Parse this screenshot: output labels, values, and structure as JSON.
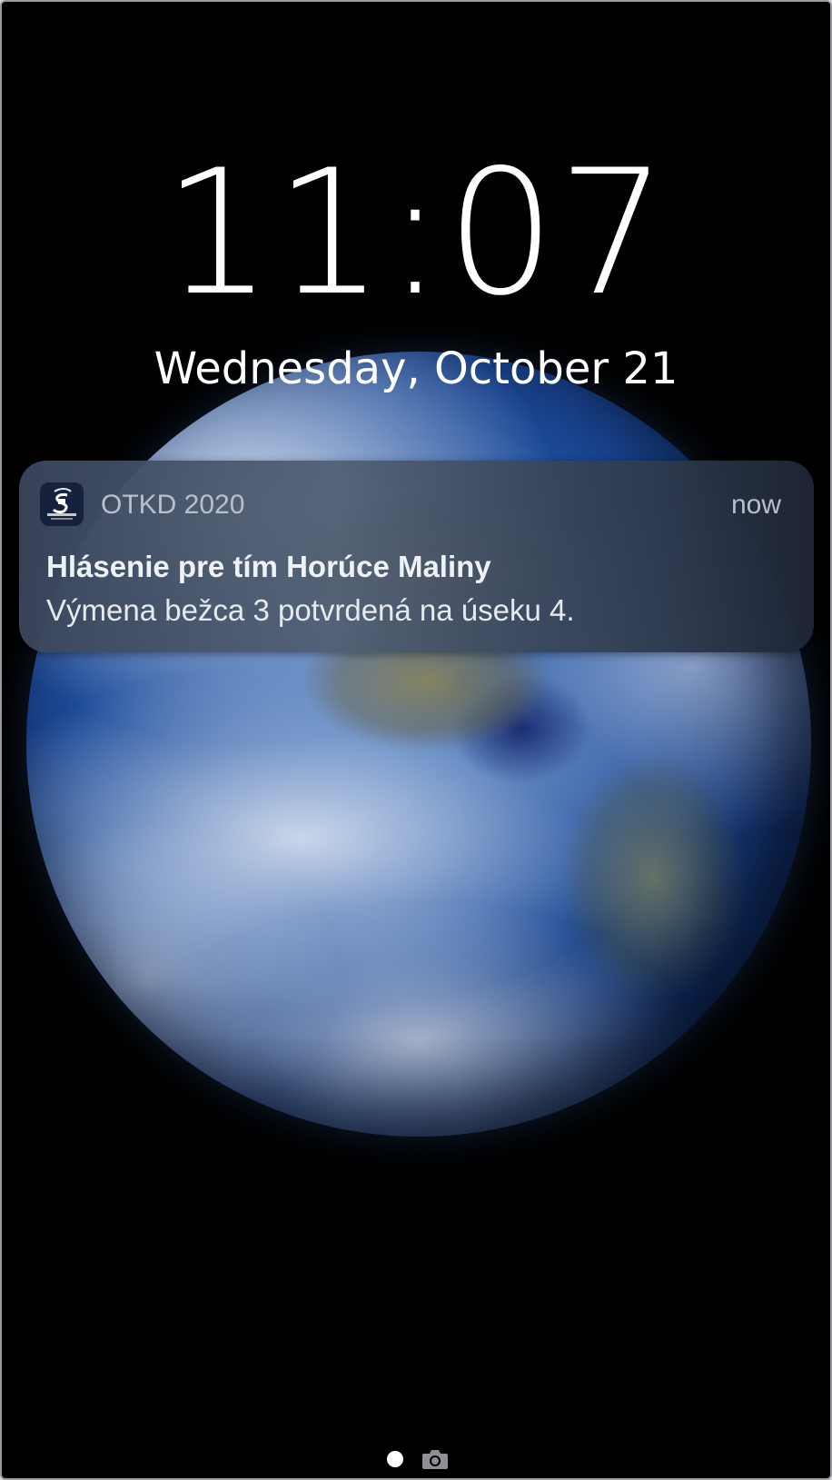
{
  "lockscreen": {
    "time": "11:07",
    "date": "Wednesday, October 21"
  },
  "notification": {
    "app_name": "OTKD 2020",
    "timestamp": "now",
    "title": "Hlásenie pre tím Horúce Maliny",
    "body": "Výmena bežca 3 potvrdená na úseku 4.",
    "app_icon": "otkd-app-icon"
  },
  "page_indicator": {
    "icons": [
      "page-dot-icon",
      "camera-icon"
    ]
  },
  "colors": {
    "background": "#000000",
    "notification_bg": "#3f4d62",
    "meta_text": "#b7c0cc",
    "text": "#eef1f6"
  }
}
